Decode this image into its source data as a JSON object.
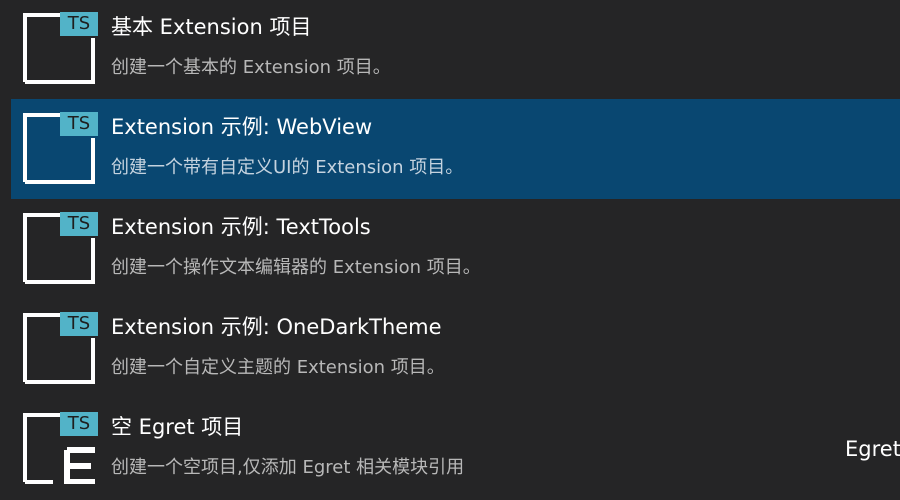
{
  "list": {
    "items": [
      {
        "icon": "ts-file-icon",
        "badge": "TS",
        "title": "基本 Extension 项目",
        "description": "创建一个基本的 Extension 项目。"
      },
      {
        "icon": "ts-file-icon",
        "badge": "TS",
        "title": "Extension 示例: WebView",
        "description": "创建一个带有自定义UI的 Extension 项目。"
      },
      {
        "icon": "ts-file-icon",
        "badge": "TS",
        "title": "Extension 示例: TextTools",
        "description": "创建一个操作文本编辑器的 Extension 项目。"
      },
      {
        "icon": "ts-file-icon",
        "badge": "TS",
        "title": "Extension 示例: OneDarkTheme",
        "description": "创建一个自定义主题的 Extension 项目。"
      },
      {
        "icon": "egret-ts-file-icon",
        "badge": "TS",
        "title": "空 Egret 项目",
        "description": "创建一个空项目,仅添加 Egret 相关模块引用"
      }
    ],
    "selected_index": 1
  },
  "side_label": "Egret",
  "colors": {
    "background": "#252526",
    "selected_background": "#094771",
    "badge": "#52b3c8",
    "title": "#ffffff",
    "description": "#b8b8b8"
  }
}
